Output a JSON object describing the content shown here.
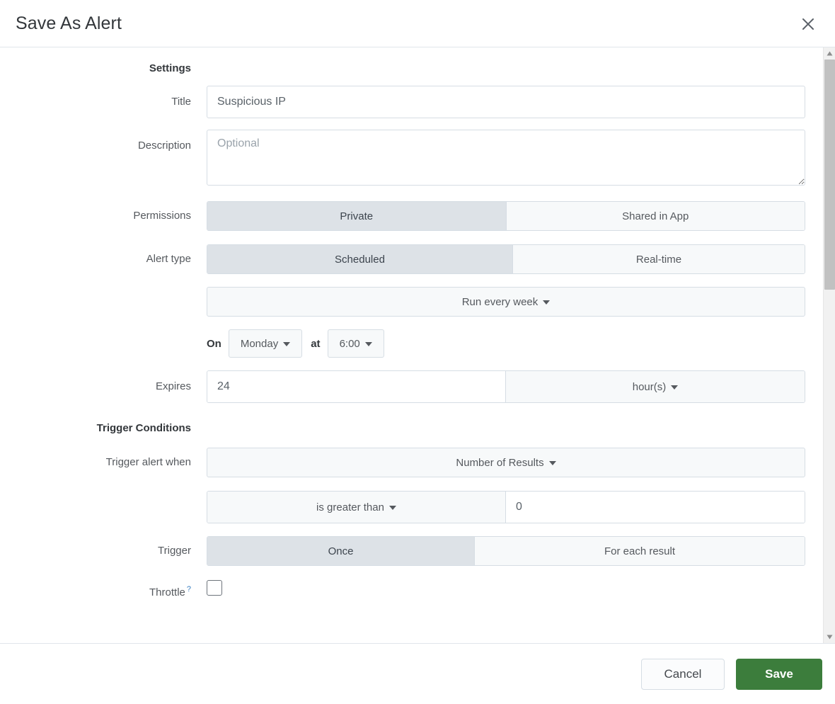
{
  "header": {
    "title": "Save As Alert",
    "close_icon": "close-icon"
  },
  "sections": {
    "settings_heading": "Settings",
    "trigger_heading": "Trigger Conditions"
  },
  "fields": {
    "title": {
      "label": "Title",
      "value": "Suspicious IP",
      "placeholder": "Title"
    },
    "description": {
      "label": "Description",
      "value": "",
      "placeholder": "Optional"
    },
    "permissions": {
      "label": "Permissions",
      "options": [
        "Private",
        "Shared in App"
      ],
      "selected": "Private"
    },
    "alert_type": {
      "label": "Alert type",
      "options": [
        "Scheduled",
        "Real-time"
      ],
      "selected": "Scheduled"
    },
    "schedule": {
      "value": "Run every week",
      "on_word": "On",
      "day": "Monday",
      "at_word": "at",
      "time": "6:00"
    },
    "expires": {
      "label": "Expires",
      "value": "24",
      "unit": "hour(s)"
    },
    "trigger_alert_when": {
      "label": "Trigger alert when",
      "value": "Number of Results",
      "comparator": "is greater than",
      "threshold": "0"
    },
    "trigger": {
      "label": "Trigger",
      "options": [
        "Once",
        "For each result"
      ],
      "selected": "Once"
    },
    "throttle": {
      "label": "Throttle",
      "help": "?",
      "checked": false
    }
  },
  "footer": {
    "cancel_label": "Cancel",
    "save_label": "Save"
  },
  "colors": {
    "save_green": "#3c7d3c",
    "selected_segment": "#dde2e7",
    "border": "#d6dde4",
    "help_link": "#3a7fc1"
  }
}
